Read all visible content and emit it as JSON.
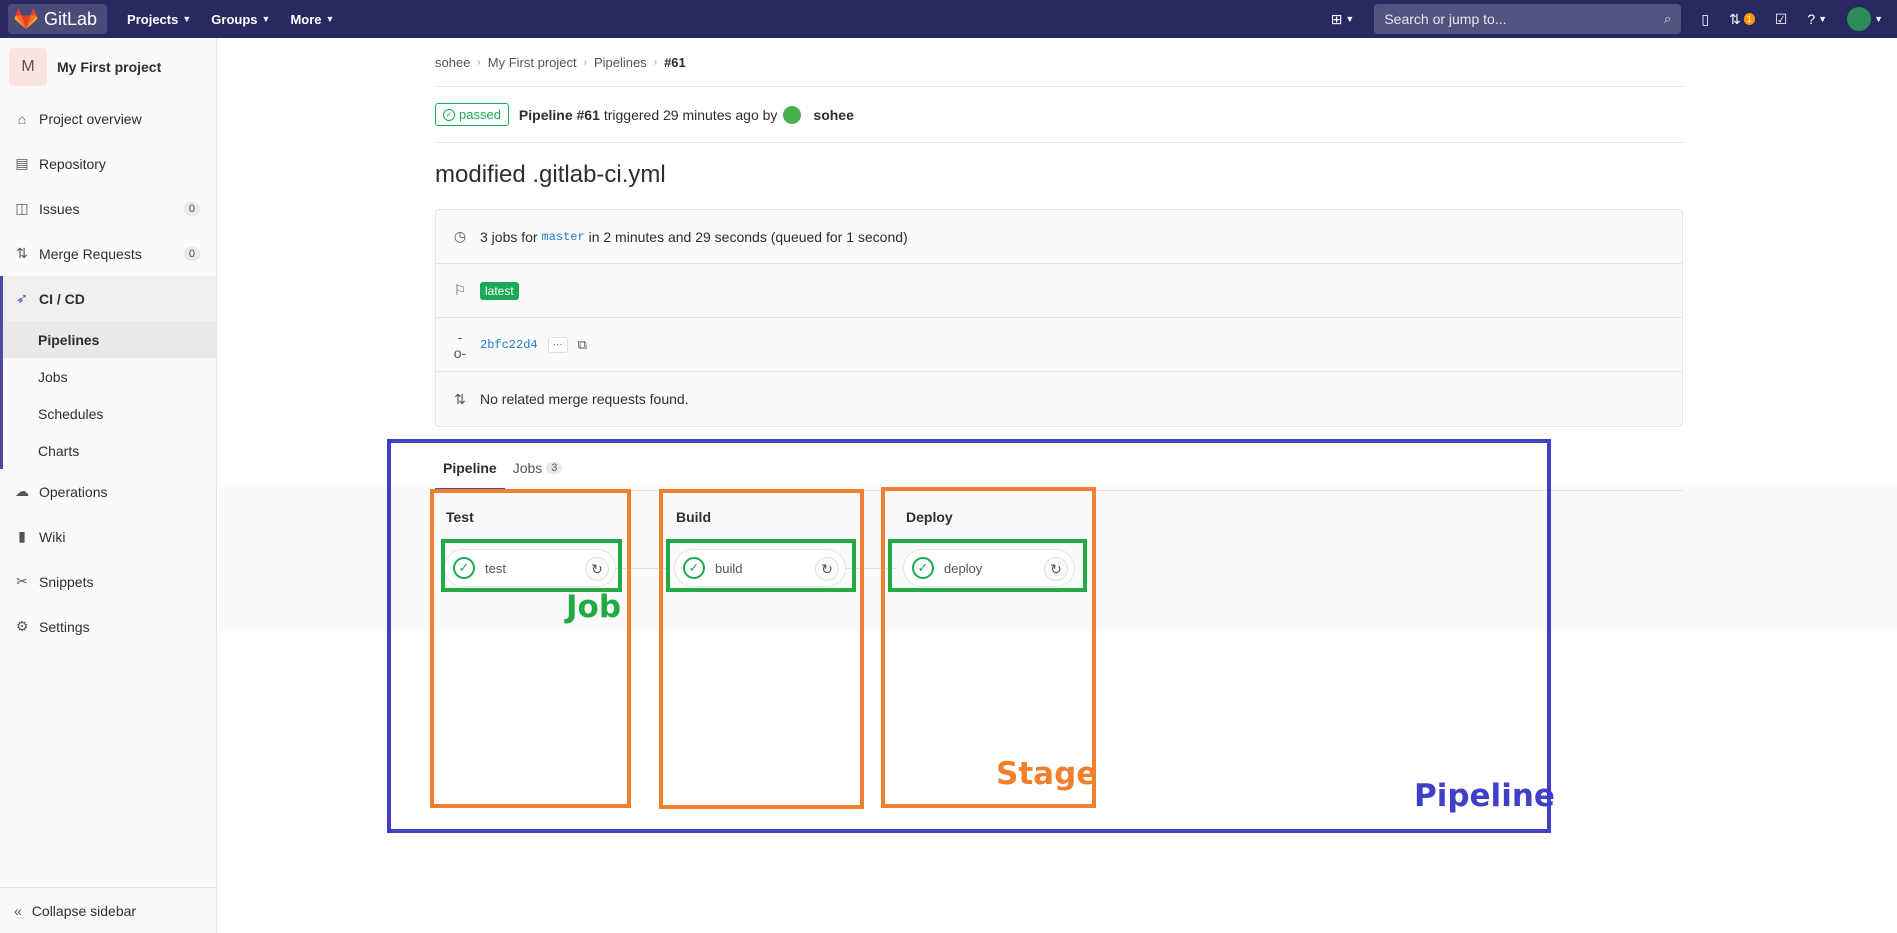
{
  "navbar": {
    "brand": "GitLab",
    "links": [
      "Projects",
      "Groups",
      "More"
    ],
    "search_placeholder": "Search or jump to...",
    "mr_badge": "1",
    "colors": {
      "bg": "#292961",
      "logo": "#e24329"
    }
  },
  "sidebar": {
    "project_avatar": "M",
    "project_name": "My First project",
    "items": [
      {
        "label": "Project overview",
        "icon": "home-icon"
      },
      {
        "label": "Repository",
        "icon": "doc-icon"
      },
      {
        "label": "Issues",
        "icon": "issues-icon",
        "count": "0"
      },
      {
        "label": "Merge Requests",
        "icon": "merge-icon",
        "count": "0"
      },
      {
        "label": "CI / CD",
        "icon": "rocket-icon"
      },
      {
        "label": "Operations",
        "icon": "cloud-icon"
      },
      {
        "label": "Wiki",
        "icon": "book-icon"
      },
      {
        "label": "Snippets",
        "icon": "scissors-icon"
      },
      {
        "label": "Settings",
        "icon": "gear-icon"
      }
    ],
    "cicd_sub": [
      "Pipelines",
      "Jobs",
      "Schedules",
      "Charts"
    ],
    "collapse_label": "Collapse sidebar"
  },
  "breadcrumb": [
    "sohee",
    "My First project",
    "Pipelines",
    "#61"
  ],
  "pipeline_header": {
    "status": "passed",
    "pipeline_label": "Pipeline #61",
    "triggered_text": "triggered 29 minutes ago by",
    "user": "sohee"
  },
  "commit_title": "modified .gitlab-ci.yml",
  "info": {
    "jobs_prefix": "3 jobs for",
    "branch": "master",
    "jobs_suffix": "in 2 minutes and 29 seconds (queued for 1 second)",
    "latest_badge": "latest",
    "sha": "2bfc22d4",
    "ellipsis": "···",
    "mr_text": "No related merge requests found."
  },
  "tabs": [
    {
      "label": "Pipeline",
      "active": true
    },
    {
      "label": "Jobs",
      "count": "3",
      "active": false
    }
  ],
  "stages": [
    {
      "name": "Test",
      "job": "test"
    },
    {
      "name": "Build",
      "job": "build"
    },
    {
      "name": "Deploy",
      "job": "deploy"
    }
  ],
  "annotations": {
    "job_label": "Job",
    "stage_label": "Stage",
    "pipeline_label": "Pipeline",
    "colors": {
      "job": "#22aa44",
      "stage": "#f07f2e",
      "pipeline": "#3f3fc8"
    }
  }
}
